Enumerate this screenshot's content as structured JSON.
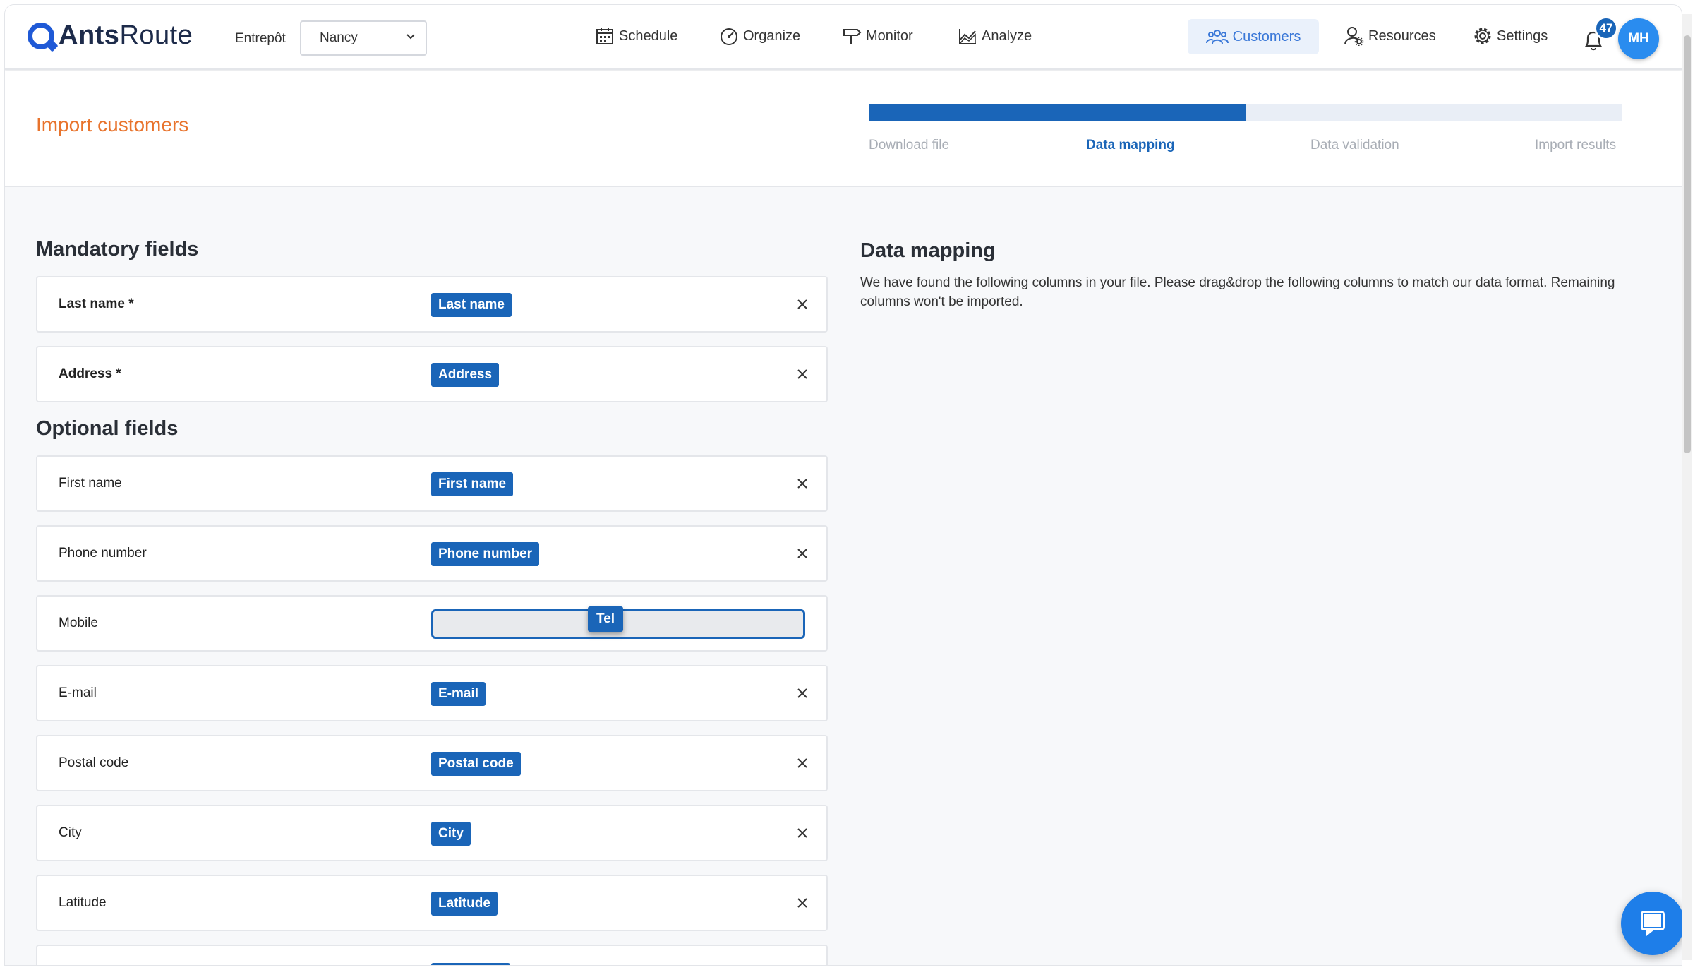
{
  "app": {
    "logo_bold": "Ants",
    "logo_light": "Route"
  },
  "header": {
    "depot_label": "Entrepôt",
    "depot_value": "Nancy",
    "nav": {
      "schedule": "Schedule",
      "organize": "Organize",
      "monitor": "Monitor",
      "analyze": "Analyze",
      "customers": "Customers",
      "resources": "Resources",
      "settings": "Settings"
    },
    "notifications_count": "47",
    "avatar_initials": "MH"
  },
  "page": {
    "title": "Import customers",
    "progress_fraction": 0.5,
    "steps": [
      "Download file",
      "Data mapping",
      "Data validation",
      "Import results"
    ],
    "active_step": 1
  },
  "mandatory": {
    "title": "Mandatory fields",
    "fields": [
      {
        "label": "Last name *",
        "chip": "Last name"
      },
      {
        "label": "Address *",
        "chip": "Address"
      }
    ]
  },
  "optional": {
    "title": "Optional fields",
    "fields": [
      {
        "label": "First name",
        "chip": "First name"
      },
      {
        "label": "Phone number",
        "chip": "Phone number"
      },
      {
        "label": "Mobile",
        "chip": ""
      },
      {
        "label": "E-mail",
        "chip": "E-mail"
      },
      {
        "label": "Postal code",
        "chip": "Postal code"
      },
      {
        "label": "City",
        "chip": "City"
      },
      {
        "label": "Latitude",
        "chip": "Latitude"
      }
    ]
  },
  "dragging_chip": "Tel",
  "info": {
    "title": "Data mapping",
    "text": "We have found the following columns in your file. Please drag&drop the following columns to match our data format. Remaining columns won't be imported."
  },
  "colors": {
    "primary": "#1a65b8",
    "accent": "#e8732c",
    "nav_active": "#3a78d8"
  }
}
